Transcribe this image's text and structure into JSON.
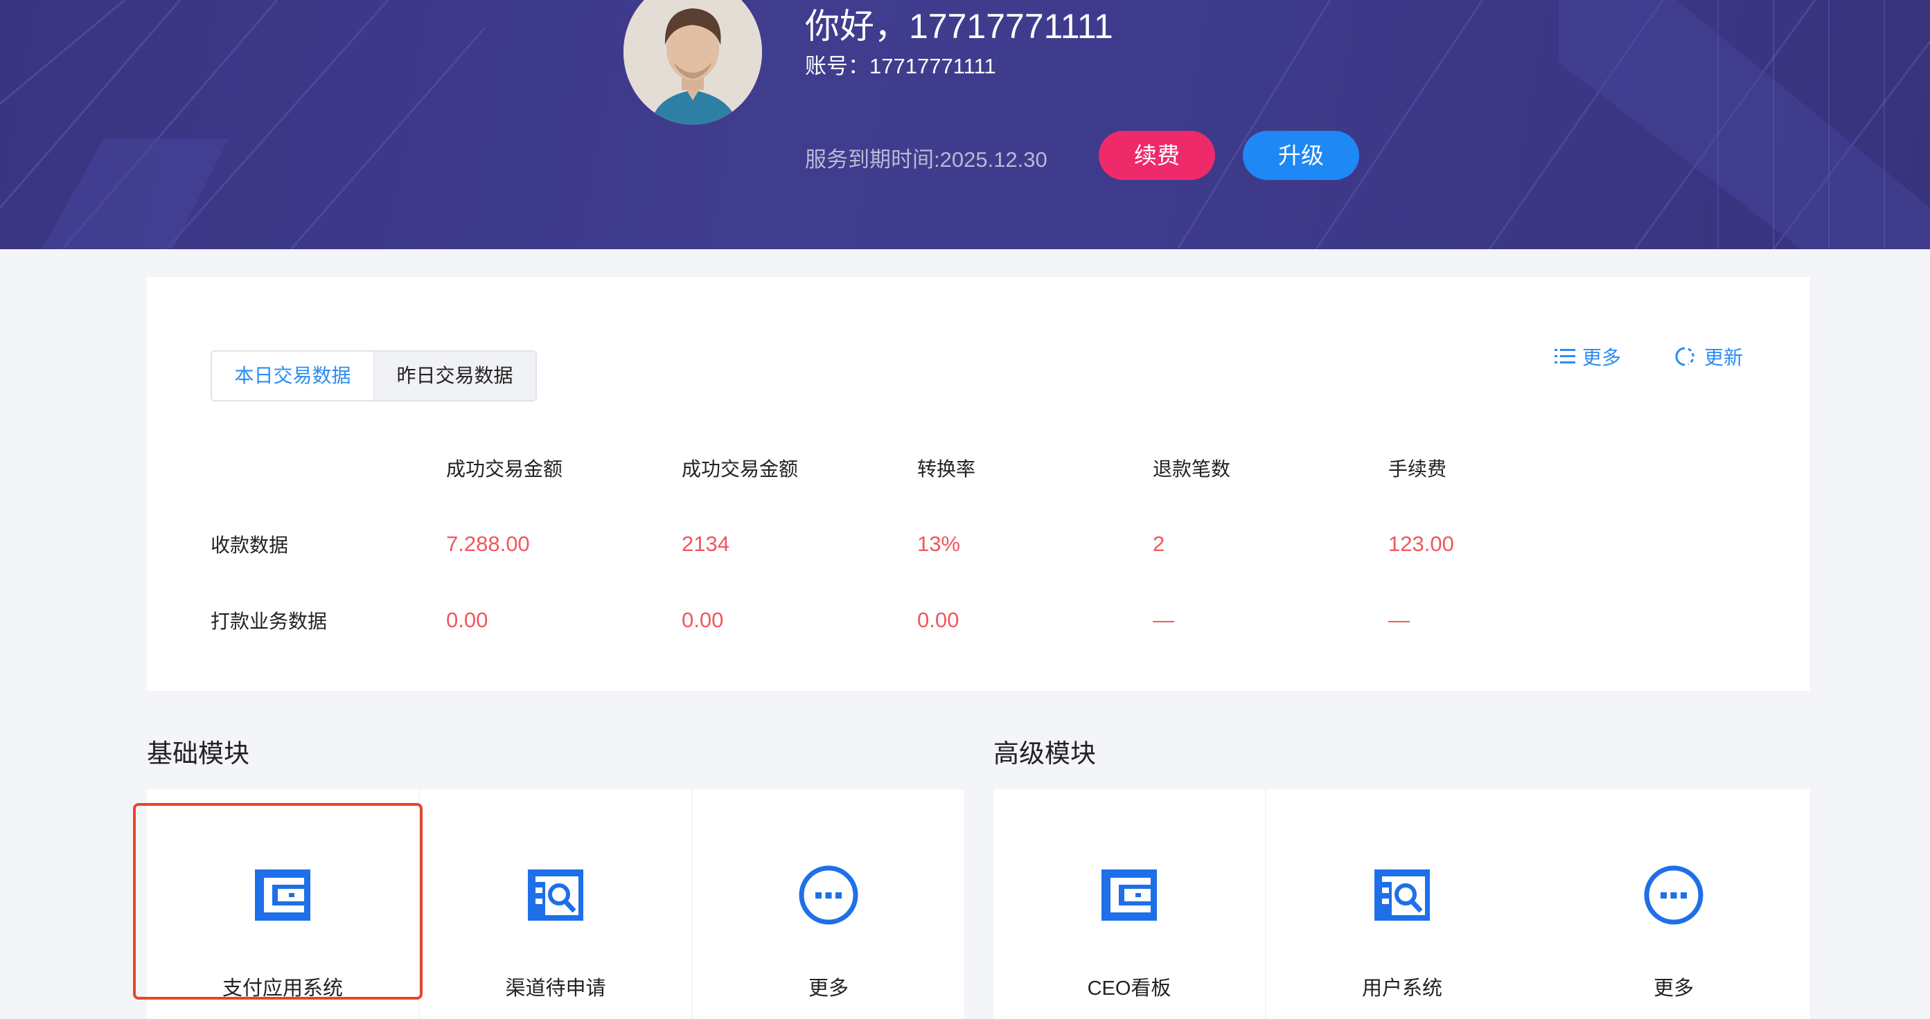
{
  "header": {
    "greeting": "你好，17717771111",
    "account": "账号：17717771111",
    "expire": "服务到期时间:2025.12.30",
    "renew_label": "续费",
    "upgrade_label": "升级",
    "renew_color": "#ee2a6a",
    "upgrade_color": "#1e88f5"
  },
  "data_card": {
    "tabs": [
      "本日交易数据",
      "昨日交易数据"
    ],
    "active_tab": "本日交易数据",
    "more_label": "更多",
    "refresh_label": "更新",
    "columns": [
      "成功交易金额",
      "成功交易金额",
      "转换率",
      "退款笔数",
      "手续费"
    ],
    "rows": [
      {
        "label": "收款数据",
        "values": [
          "7.288.00",
          "2134",
          "13%",
          "2",
          "123.00"
        ]
      },
      {
        "label": "打款业务数据",
        "values": [
          "0.00",
          "0.00",
          "0.00",
          "—",
          "—"
        ]
      }
    ],
    "value_color": "#f2565d"
  },
  "modules": {
    "basic": {
      "title": "基础模块",
      "items": [
        {
          "label": "支付应用系统",
          "icon": "window-card-icon",
          "selected": true
        },
        {
          "label": "渠道待申请",
          "icon": "document-search-icon"
        },
        {
          "label": "更多",
          "icon": "more-dots-icon"
        }
      ]
    },
    "advanced": {
      "title": "高级模块",
      "items": [
        {
          "label": "CEO看板",
          "icon": "window-card-icon"
        },
        {
          "label": "用户系统",
          "icon": "document-search-icon"
        },
        {
          "label": "更多",
          "icon": "more-dots-icon"
        }
      ]
    },
    "accent_color": "#1e6fe8"
  }
}
